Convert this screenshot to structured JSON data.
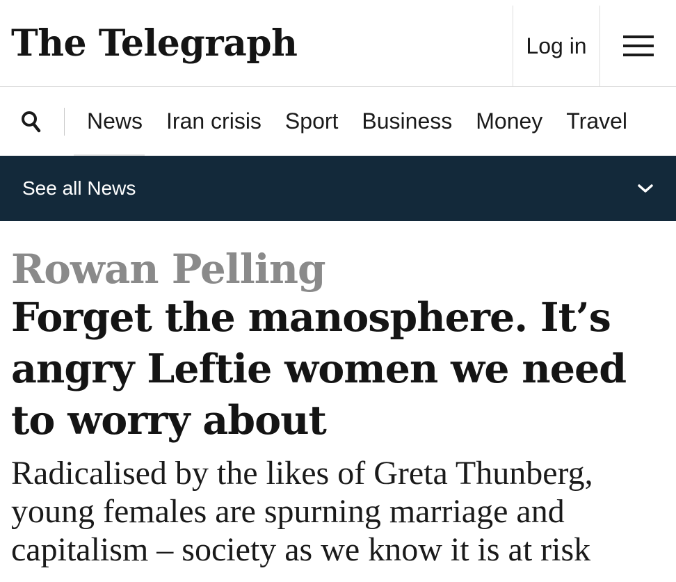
{
  "masthead": {
    "logo_text": "The Telegraph",
    "login_label": "Log in",
    "menu_icon": "hamburger-menu-icon"
  },
  "nav": {
    "search_icon": "search-icon",
    "items": [
      {
        "label": "News"
      },
      {
        "label": "Iran crisis"
      },
      {
        "label": "Sport"
      },
      {
        "label": "Business"
      },
      {
        "label": "Money"
      },
      {
        "label": "Travel"
      }
    ]
  },
  "section_bar": {
    "label": "See all News",
    "toggle_icon": "chevron-down-icon",
    "background_color": "#13293a"
  },
  "article": {
    "author": "Rowan Pelling",
    "headline": "Forget the manosphere. It’s angry Leftie women we need to worry about",
    "standfirst": "Radicalised by the likes of Greta Thunberg, young females are spurning marriage and capitalism – society as we know it is at risk"
  },
  "colors": {
    "author_grey": "#8a8a8a",
    "text_dark": "#141414"
  }
}
